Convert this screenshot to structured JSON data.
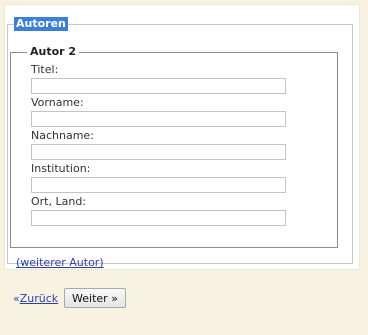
{
  "form": {
    "section_legend": "Autoren",
    "author_legend": "Autor 2",
    "fields": [
      {
        "label": "Titel:",
        "value": ""
      },
      {
        "label": "Vorname:",
        "value": ""
      },
      {
        "label": "Nachname:",
        "value": ""
      },
      {
        "label": "Institution:",
        "value": ""
      },
      {
        "label": "Ort, Land:",
        "value": ""
      }
    ],
    "more_author_link": "(weiterer Autor)"
  },
  "navigation": {
    "back_prefix": "«",
    "back_link": "Zurück",
    "next_button": "Weiter »"
  }
}
